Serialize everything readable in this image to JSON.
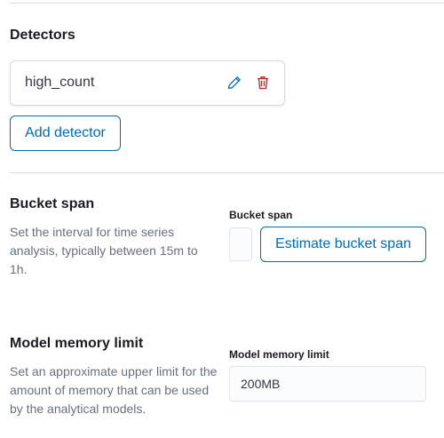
{
  "detectors": {
    "title": "Detectors",
    "items": [
      {
        "name": "high_count",
        "edit_icon": "pencil-icon",
        "delete_icon": "trash-icon"
      }
    ],
    "add_button_label": "Add detector"
  },
  "bucket_span": {
    "title": "Bucket span",
    "description": "Set the interval for time series analysis, typically between 15m to 1h.",
    "field_label": "Bucket span",
    "input_value": "",
    "estimate_button_label": "Estimate bucket span"
  },
  "model_memory": {
    "title": "Model memory limit",
    "description": "Set an approximate upper limit for the amount of memory that can be used by the analytical models.",
    "field_label": "Model memory limit",
    "input_value": "200MB"
  },
  "colors": {
    "primary": "#006bb8",
    "danger": "#bd271e",
    "border": "#d3dae6",
    "muted_text": "#69707d"
  }
}
